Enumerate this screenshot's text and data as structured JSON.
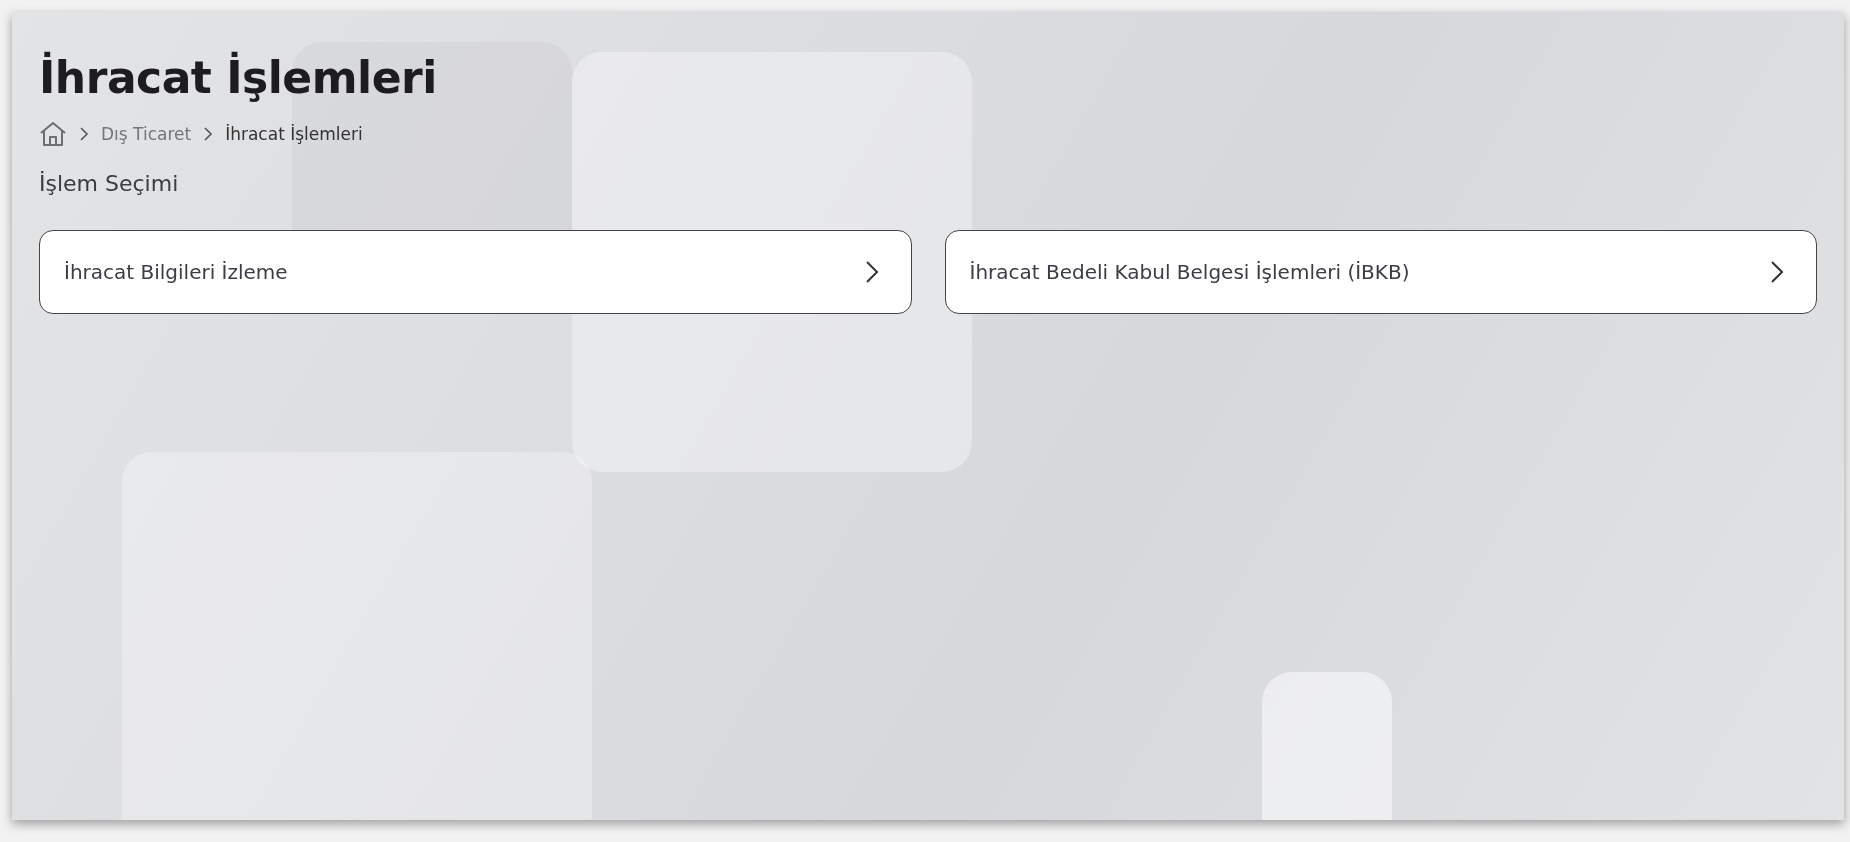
{
  "title": "İhracat İşlemleri",
  "breadcrumb": [
    {
      "label": "Dış Ticaret",
      "current": false
    },
    {
      "label": "İhracat İşlemleri",
      "current": true
    }
  ],
  "section_title": "İşlem Seçimi",
  "options": [
    {
      "label": "İhracat Bilgileri İzleme"
    },
    {
      "label": "İhracat Bedeli Kabul Belgesi İşlemleri (İBKB)"
    }
  ]
}
